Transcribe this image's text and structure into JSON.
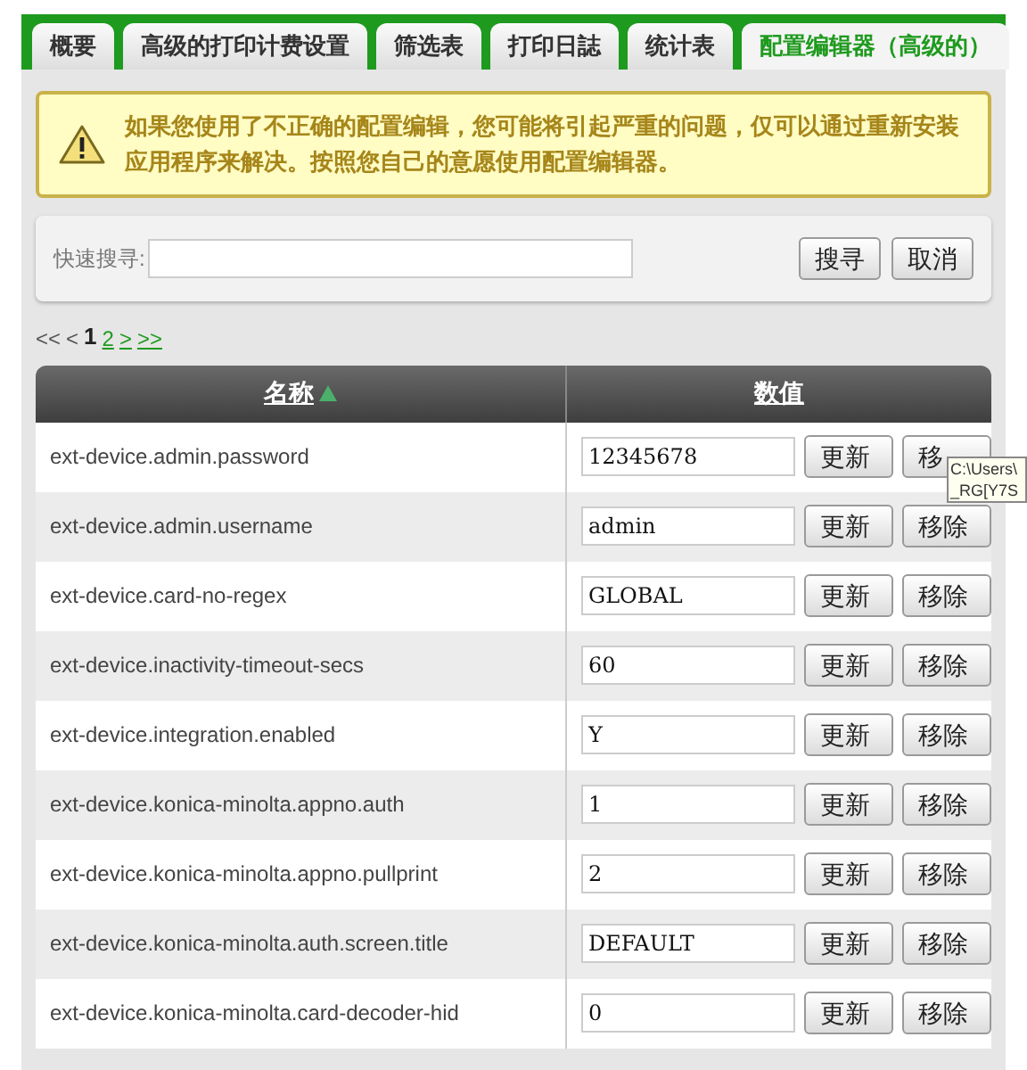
{
  "tabs": [
    {
      "label": "概要",
      "selected": false
    },
    {
      "label": "高级的打印计费设置",
      "selected": false
    },
    {
      "label": "筛选表",
      "selected": false
    },
    {
      "label": "打印日誌",
      "selected": false
    },
    {
      "label": "统计表",
      "selected": false
    },
    {
      "label": "配置编辑器（高级的）",
      "selected": true
    }
  ],
  "warning": "如果您使用了不正确的配置编辑，您可能将引起严重的问题，仅可以通过重新安装应用程序来解决。按照您自己的意愿使用配置编辑器。",
  "search": {
    "label": "快速搜寻:",
    "buttons": [
      "搜寻",
      "取消"
    ]
  },
  "pagination": [
    {
      "label": "<<",
      "kind": "text"
    },
    {
      "label": "<",
      "kind": "text"
    },
    {
      "label": "1",
      "kind": "current"
    },
    {
      "label": "2",
      "kind": "link"
    },
    {
      "label": ">",
      "kind": "link"
    },
    {
      "label": ">>",
      "kind": "link"
    }
  ],
  "table": {
    "columns": [
      {
        "label": "名称",
        "sorted": true
      },
      {
        "label": "数值",
        "sorted": false
      }
    ],
    "rows": [
      {
        "name": "ext-device.admin.password",
        "value": "12345678",
        "buttons": [
          "更新",
          "移"
        ]
      },
      {
        "name": "ext-device.admin.username",
        "value": "admin",
        "buttons": [
          "更新",
          "移除"
        ]
      },
      {
        "name": "ext-device.card-no-regex",
        "value": "GLOBAL",
        "buttons": [
          "更新",
          "移除"
        ]
      },
      {
        "name": "ext-device.inactivity-timeout-secs",
        "value": "60",
        "buttons": [
          "更新",
          "移除"
        ]
      },
      {
        "name": "ext-device.integration.enabled",
        "value": "Y",
        "buttons": [
          "更新",
          "移除"
        ]
      },
      {
        "name": "ext-device.konica-minolta.appno.auth",
        "value": "1",
        "buttons": [
          "更新",
          "移除"
        ]
      },
      {
        "name": "ext-device.konica-minolta.appno.pullprint",
        "value": "2",
        "buttons": [
          "更新",
          "移除"
        ]
      },
      {
        "name": "ext-device.konica-minolta.auth.screen.title",
        "value": "DEFAULT",
        "buttons": [
          "更新",
          "移除"
        ]
      },
      {
        "name": "ext-device.konica-minolta.card-decoder-hid",
        "value": "0",
        "buttons": [
          "更新",
          "移除"
        ]
      }
    ]
  },
  "tooltip": {
    "lines": [
      "C:\\Users\\",
      "_RG[Y7S"
    ]
  }
}
